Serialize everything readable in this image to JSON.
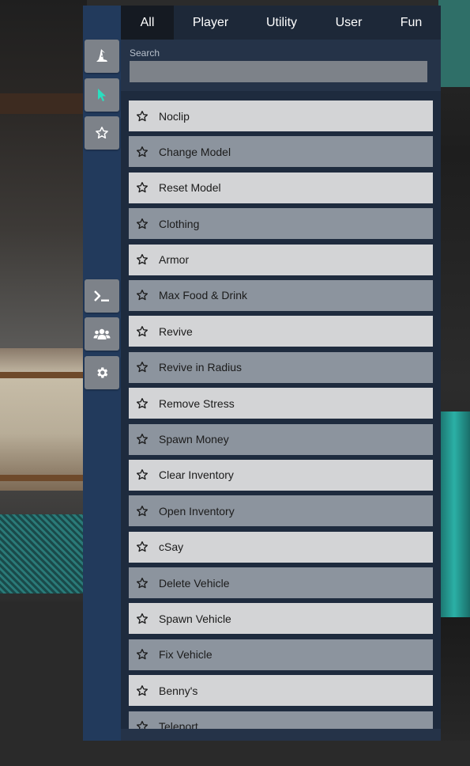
{
  "tabs": [
    "All",
    "Player",
    "Utility",
    "User",
    "Fun"
  ],
  "search": {
    "label": "Search",
    "value": "",
    "placeholder": ""
  },
  "sidebar": {
    "items": [
      {
        "icon": "wizard-hat-icon"
      },
      {
        "icon": "cursor-icon",
        "accent": "#29e0c0"
      },
      {
        "icon": "star-icon"
      },
      {
        "icon": "terminal-icon"
      },
      {
        "icon": "users-icon"
      },
      {
        "icon": "gear-icon"
      }
    ]
  },
  "commands": [
    {
      "label": "Noclip"
    },
    {
      "label": "Change Model"
    },
    {
      "label": "Reset Model"
    },
    {
      "label": "Clothing"
    },
    {
      "label": "Armor"
    },
    {
      "label": "Max Food & Drink"
    },
    {
      "label": "Revive"
    },
    {
      "label": "Revive in Radius"
    },
    {
      "label": "Remove Stress"
    },
    {
      "label": "Spawn Money"
    },
    {
      "label": "Clear Inventory"
    },
    {
      "label": "Open Inventory"
    },
    {
      "label": "cSay"
    },
    {
      "label": "Delete Vehicle"
    },
    {
      "label": "Spawn Vehicle"
    },
    {
      "label": "Fix Vehicle"
    },
    {
      "label": "Benny's"
    },
    {
      "label": "Teleport"
    }
  ],
  "colors": {
    "accent": "#29e0c0",
    "panel": "#253348",
    "sidebar": "#223a5c",
    "row_light": "#d3d4d6",
    "row_dark": "#8c949e"
  }
}
